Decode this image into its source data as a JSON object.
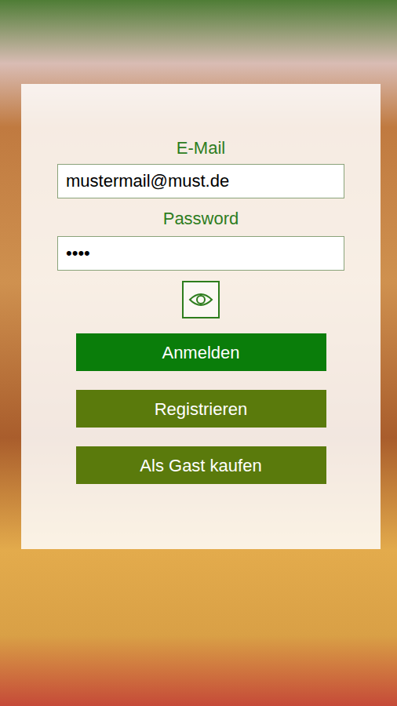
{
  "form": {
    "email_label": "E-Mail",
    "email_value": "mustermail@must.de",
    "password_label": "Password",
    "password_value": "••••"
  },
  "buttons": [
    {
      "label": "Anmelden",
      "kind": "primary"
    },
    {
      "label": "Registrieren",
      "kind": "secondary"
    },
    {
      "label": "Als Gast kaufen",
      "kind": "secondary"
    }
  ]
}
